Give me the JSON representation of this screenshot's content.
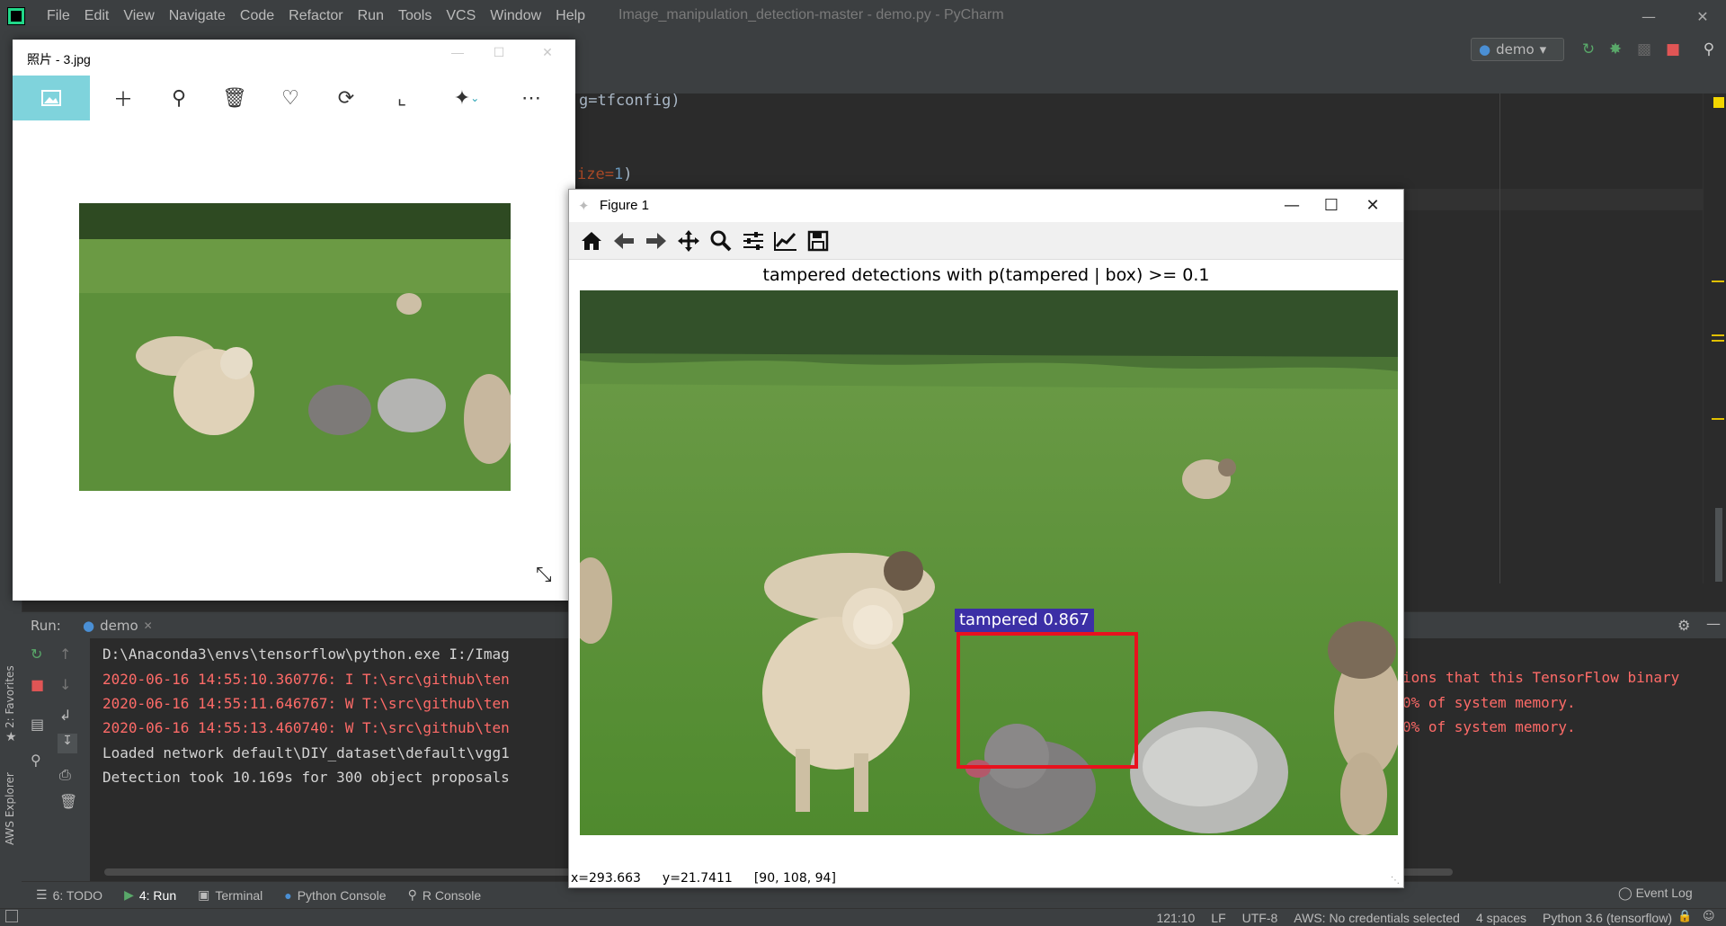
{
  "ide": {
    "menu": [
      "File",
      "Edit",
      "View",
      "Navigate",
      "Code",
      "Refactor",
      "Run",
      "Tools",
      "VCS",
      "Window",
      "Help"
    ],
    "window_title": "Image_manipulation_detection-master - demo.py - PyCharm",
    "run_config": "demo",
    "editor_lines": [
      "g=tfconfig)",
      "ize=1)"
    ],
    "run_label": "Run:",
    "run_tab": "demo",
    "console_lines": [
      "D:\\Anaconda3\\envs\\tensorflow\\python.exe I:/Imag",
      "2020-06-16 14:55:10.360776: I T:\\src\\github\\ten",
      "2020-06-16 14:55:11.646767: W T:\\src\\github\\ten",
      "2020-06-16 14:55:13.460740: W T:\\src\\github\\ten",
      "Loaded network default\\DIY_dataset\\default\\vgg1",
      "Detection took 10.169s for 300 object proposals"
    ],
    "console_right_lines": [
      "ions that this TensorFlow binary",
      "0% of system memory.",
      "0% of system memory."
    ],
    "bottom_tabs": [
      "6: TODO",
      "4: Run",
      "Terminal",
      "Python Console",
      "R Console"
    ],
    "event_log": "Event Log",
    "left_strip_labels": [
      "2: Favorites",
      "AWS Explorer"
    ],
    "status": {
      "position": "121:10",
      "line_sep": "LF",
      "encoding": "UTF-8",
      "aws": "AWS: No credentials selected",
      "indent": "4 spaces",
      "interpreter": "Python 3.6 (tensorflow)"
    }
  },
  "photos": {
    "title": "照片 - 3.jpg"
  },
  "figure": {
    "title": "Figure 1",
    "heading": "tampered detections with p(tampered | box) >= 0.1",
    "detection_label": "tampered 0.867",
    "status": {
      "x": "x=293.663",
      "y": "y=21.7411",
      "rgb": "[90, 108, 94]"
    }
  },
  "colors": {
    "accent": "#7fd3dc",
    "detection_box": "#e8121e",
    "detection_label_bg": "#3c2fa6",
    "console_error": "#ff6b68"
  }
}
